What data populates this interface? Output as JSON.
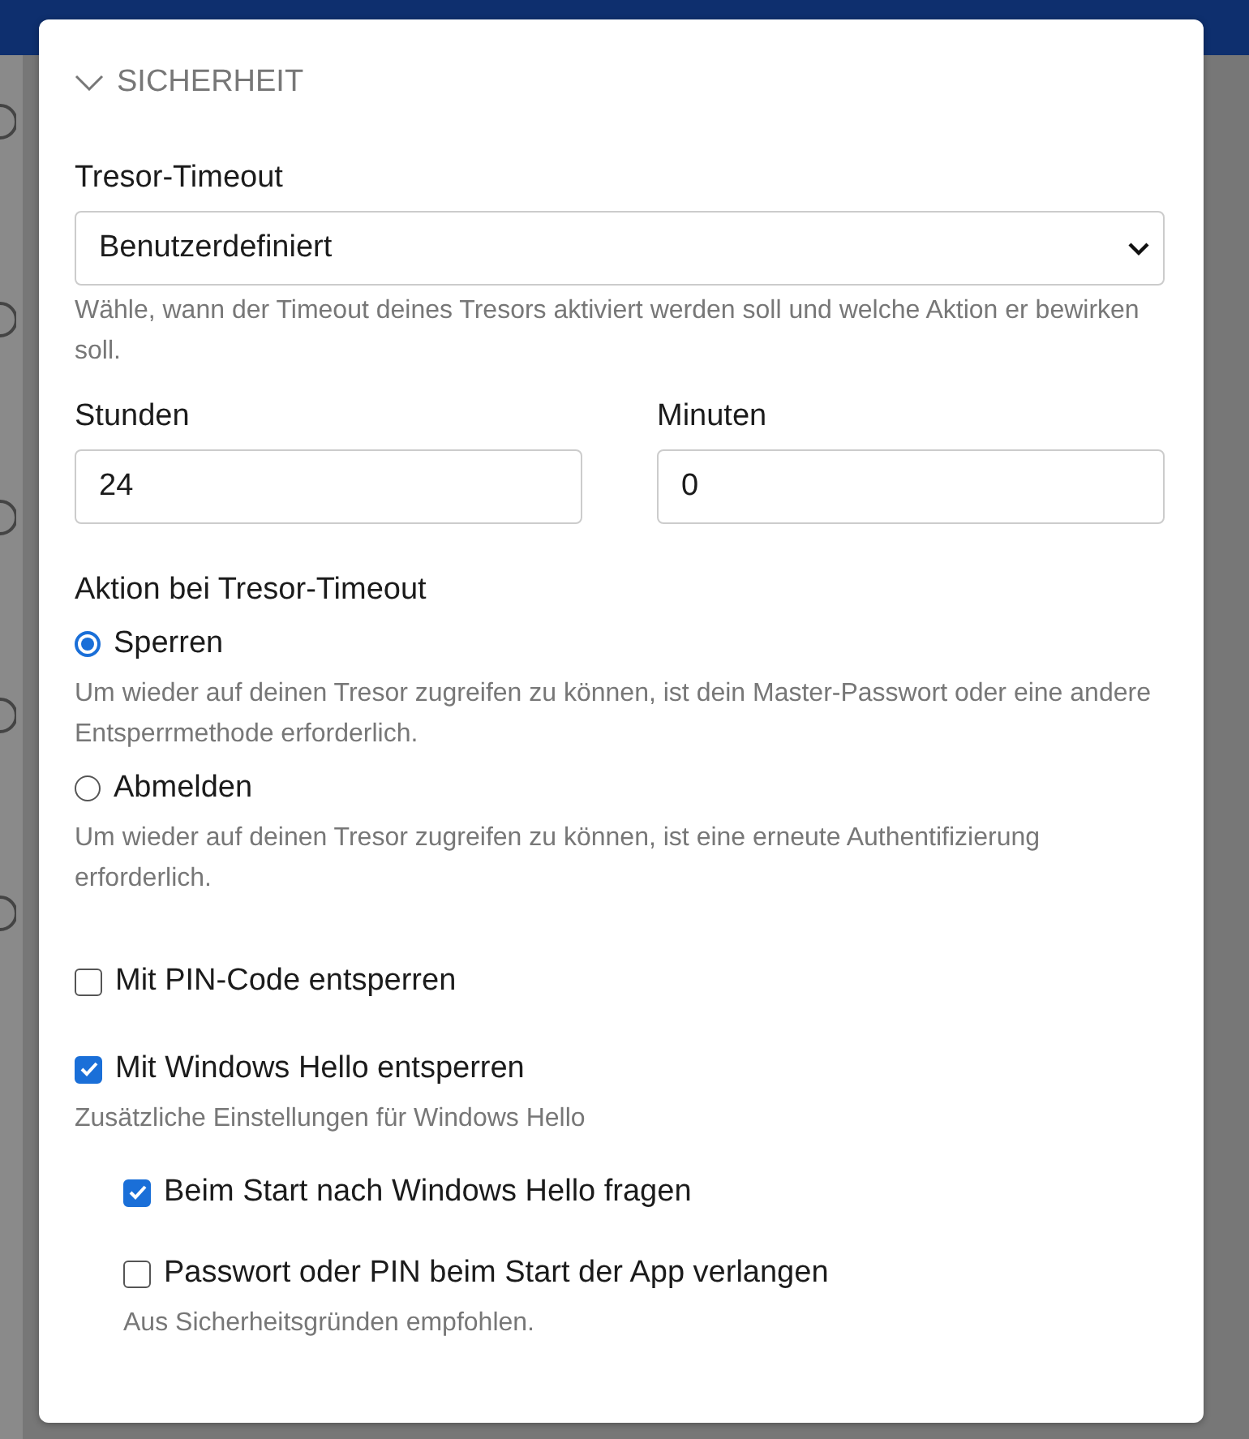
{
  "section": {
    "title": "SICHERHEIT",
    "expanded": true
  },
  "timeout": {
    "label": "Tresor-Timeout",
    "value": "Benutzerdefiniert",
    "hint": "Wähle, wann der Timeout deines Tresors aktiviert werden soll und welche Aktion er bewirken soll."
  },
  "time_fields": [
    {
      "label": "Stunden",
      "value": "24"
    },
    {
      "label": "Minuten",
      "value": "0"
    }
  ],
  "action": {
    "label": "Aktion bei Tresor-Timeout",
    "options": [
      {
        "label": "Sperren",
        "selected": true,
        "hint": "Um wieder auf deinen Tresor zugreifen zu können, ist dein Master-Passwort oder eine andere Entsperrmethode erforderlich."
      },
      {
        "label": "Abmelden",
        "selected": false,
        "hint": "Um wieder auf deinen Tresor zugreifen zu können, ist eine erneute Authentifizierung erforderlich."
      }
    ]
  },
  "options": [
    {
      "label": "Mit PIN-Code entsperren",
      "checked": false
    },
    {
      "label": "Mit Windows Hello entsperren",
      "checked": true,
      "hint": "Zusätzliche Einstellungen für Windows Hello",
      "children": [
        {
          "label": "Beim Start nach Windows Hello fragen",
          "checked": true
        },
        {
          "label": "Passwort oder PIN beim Start der App verlangen",
          "checked": false,
          "hint": "Aus Sicherheitsgründen empfohlen."
        }
      ]
    }
  ]
}
